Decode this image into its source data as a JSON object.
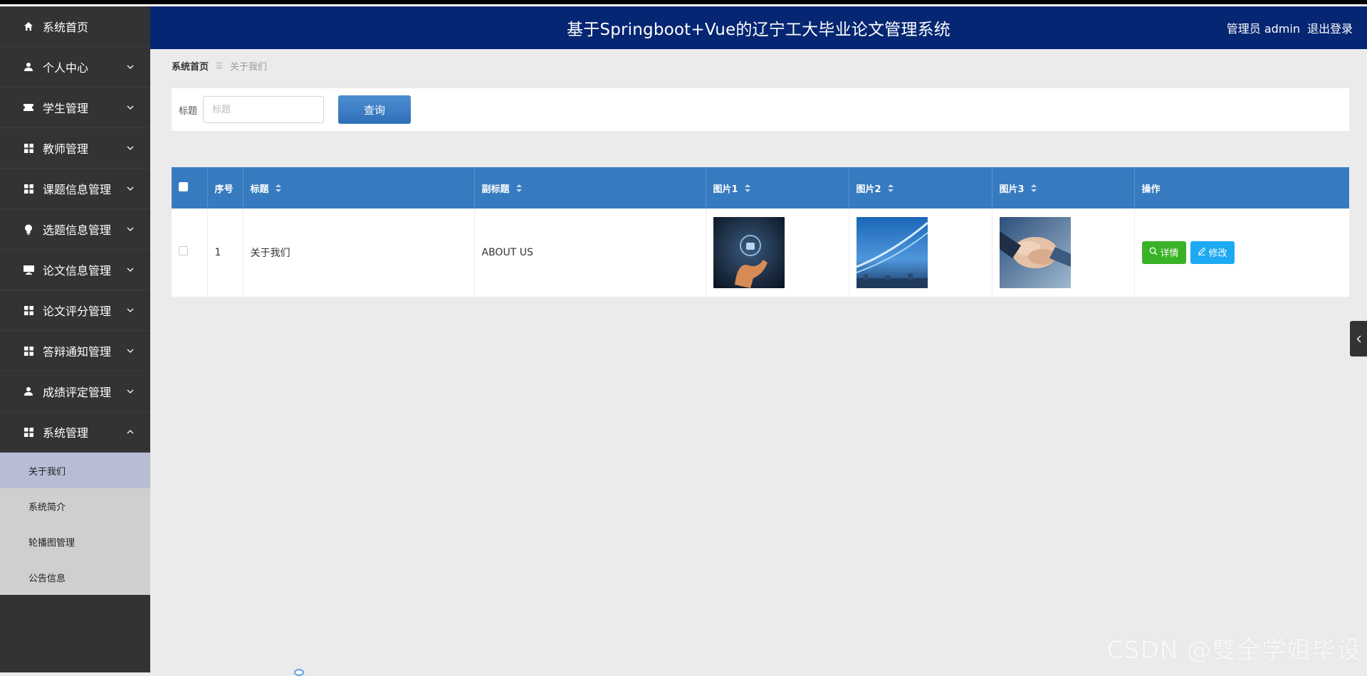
{
  "header": {
    "title": "基于Springboot+Vue的辽宁工大毕业论文管理系统",
    "user": "管理员 admin",
    "logout": "退出登录"
  },
  "sidebar": {
    "items": [
      {
        "label": "系统首页",
        "icon": "home-icon",
        "expandable": false
      },
      {
        "label": "个人中心",
        "icon": "user-icon",
        "expandable": true
      },
      {
        "label": "学生管理",
        "icon": "ticket-icon",
        "expandable": true
      },
      {
        "label": "教师管理",
        "icon": "grid-icon",
        "expandable": true
      },
      {
        "label": "课题信息管理",
        "icon": "grid-icon",
        "expandable": true
      },
      {
        "label": "选题信息管理",
        "icon": "bulb-icon",
        "expandable": true
      },
      {
        "label": "论文信息管理",
        "icon": "monitor-icon",
        "expandable": true
      },
      {
        "label": "论文评分管理",
        "icon": "grid-icon",
        "expandable": true
      },
      {
        "label": "答辩通知管理",
        "icon": "grid-icon",
        "expandable": true
      },
      {
        "label": "成绩评定管理",
        "icon": "user-icon",
        "expandable": true
      },
      {
        "label": "系统管理",
        "icon": "grid-icon",
        "expandable": true,
        "expanded": true
      }
    ],
    "submenu": [
      {
        "label": "关于我们",
        "active": true
      },
      {
        "label": "系统简介",
        "active": false
      },
      {
        "label": "轮播图管理",
        "active": false
      },
      {
        "label": "公告信息",
        "active": false
      }
    ]
  },
  "breadcrumb": {
    "home": "系统首页",
    "separator": "☰",
    "current": "关于我们"
  },
  "search": {
    "label": "标题",
    "placeholder": "标题",
    "button": "查询"
  },
  "table": {
    "columns": [
      "序号",
      "标题",
      "副标题",
      "图片1",
      "图片2",
      "图片3",
      "操作"
    ],
    "rows": [
      {
        "index": "1",
        "title": "关于我们",
        "subtitle": "ABOUT US"
      }
    ],
    "actions": {
      "detail": "详情",
      "edit": "修改"
    }
  },
  "watermark": "CSDN @雙全学姐毕设",
  "colors": {
    "header": "#052672",
    "sidebar": "#333333",
    "table_header": "#367bbf",
    "detail_button": "#3ab227",
    "edit_button": "#1daaf2"
  }
}
